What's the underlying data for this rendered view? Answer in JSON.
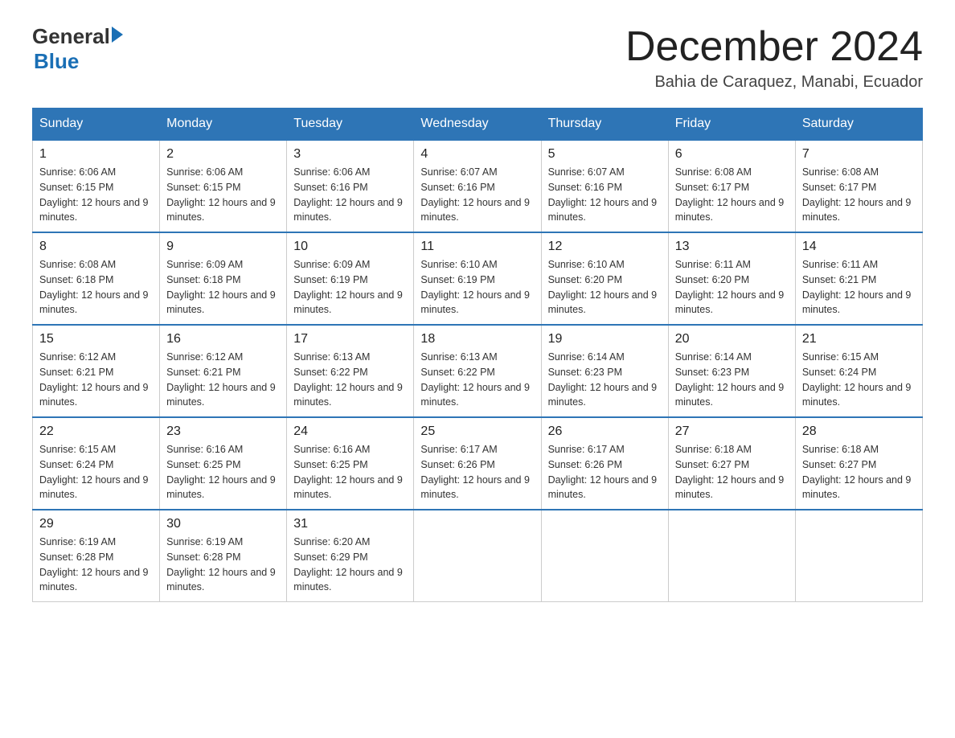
{
  "header": {
    "logo": {
      "general": "General",
      "blue": "Blue"
    },
    "title": "December 2024",
    "subtitle": "Bahia de Caraquez, Manabi, Ecuador"
  },
  "days_of_week": [
    "Sunday",
    "Monday",
    "Tuesday",
    "Wednesday",
    "Thursday",
    "Friday",
    "Saturday"
  ],
  "weeks": [
    [
      {
        "day": "1",
        "sunrise": "6:06 AM",
        "sunset": "6:15 PM",
        "daylight": "12 hours and 9 minutes."
      },
      {
        "day": "2",
        "sunrise": "6:06 AM",
        "sunset": "6:15 PM",
        "daylight": "12 hours and 9 minutes."
      },
      {
        "day": "3",
        "sunrise": "6:06 AM",
        "sunset": "6:16 PM",
        "daylight": "12 hours and 9 minutes."
      },
      {
        "day": "4",
        "sunrise": "6:07 AM",
        "sunset": "6:16 PM",
        "daylight": "12 hours and 9 minutes."
      },
      {
        "day": "5",
        "sunrise": "6:07 AM",
        "sunset": "6:16 PM",
        "daylight": "12 hours and 9 minutes."
      },
      {
        "day": "6",
        "sunrise": "6:08 AM",
        "sunset": "6:17 PM",
        "daylight": "12 hours and 9 minutes."
      },
      {
        "day": "7",
        "sunrise": "6:08 AM",
        "sunset": "6:17 PM",
        "daylight": "12 hours and 9 minutes."
      }
    ],
    [
      {
        "day": "8",
        "sunrise": "6:08 AM",
        "sunset": "6:18 PM",
        "daylight": "12 hours and 9 minutes."
      },
      {
        "day": "9",
        "sunrise": "6:09 AM",
        "sunset": "6:18 PM",
        "daylight": "12 hours and 9 minutes."
      },
      {
        "day": "10",
        "sunrise": "6:09 AM",
        "sunset": "6:19 PM",
        "daylight": "12 hours and 9 minutes."
      },
      {
        "day": "11",
        "sunrise": "6:10 AM",
        "sunset": "6:19 PM",
        "daylight": "12 hours and 9 minutes."
      },
      {
        "day": "12",
        "sunrise": "6:10 AM",
        "sunset": "6:20 PM",
        "daylight": "12 hours and 9 minutes."
      },
      {
        "day": "13",
        "sunrise": "6:11 AM",
        "sunset": "6:20 PM",
        "daylight": "12 hours and 9 minutes."
      },
      {
        "day": "14",
        "sunrise": "6:11 AM",
        "sunset": "6:21 PM",
        "daylight": "12 hours and 9 minutes."
      }
    ],
    [
      {
        "day": "15",
        "sunrise": "6:12 AM",
        "sunset": "6:21 PM",
        "daylight": "12 hours and 9 minutes."
      },
      {
        "day": "16",
        "sunrise": "6:12 AM",
        "sunset": "6:21 PM",
        "daylight": "12 hours and 9 minutes."
      },
      {
        "day": "17",
        "sunrise": "6:13 AM",
        "sunset": "6:22 PM",
        "daylight": "12 hours and 9 minutes."
      },
      {
        "day": "18",
        "sunrise": "6:13 AM",
        "sunset": "6:22 PM",
        "daylight": "12 hours and 9 minutes."
      },
      {
        "day": "19",
        "sunrise": "6:14 AM",
        "sunset": "6:23 PM",
        "daylight": "12 hours and 9 minutes."
      },
      {
        "day": "20",
        "sunrise": "6:14 AM",
        "sunset": "6:23 PM",
        "daylight": "12 hours and 9 minutes."
      },
      {
        "day": "21",
        "sunrise": "6:15 AM",
        "sunset": "6:24 PM",
        "daylight": "12 hours and 9 minutes."
      }
    ],
    [
      {
        "day": "22",
        "sunrise": "6:15 AM",
        "sunset": "6:24 PM",
        "daylight": "12 hours and 9 minutes."
      },
      {
        "day": "23",
        "sunrise": "6:16 AM",
        "sunset": "6:25 PM",
        "daylight": "12 hours and 9 minutes."
      },
      {
        "day": "24",
        "sunrise": "6:16 AM",
        "sunset": "6:25 PM",
        "daylight": "12 hours and 9 minutes."
      },
      {
        "day": "25",
        "sunrise": "6:17 AM",
        "sunset": "6:26 PM",
        "daylight": "12 hours and 9 minutes."
      },
      {
        "day": "26",
        "sunrise": "6:17 AM",
        "sunset": "6:26 PM",
        "daylight": "12 hours and 9 minutes."
      },
      {
        "day": "27",
        "sunrise": "6:18 AM",
        "sunset": "6:27 PM",
        "daylight": "12 hours and 9 minutes."
      },
      {
        "day": "28",
        "sunrise": "6:18 AM",
        "sunset": "6:27 PM",
        "daylight": "12 hours and 9 minutes."
      }
    ],
    [
      {
        "day": "29",
        "sunrise": "6:19 AM",
        "sunset": "6:28 PM",
        "daylight": "12 hours and 9 minutes."
      },
      {
        "day": "30",
        "sunrise": "6:19 AM",
        "sunset": "6:28 PM",
        "daylight": "12 hours and 9 minutes."
      },
      {
        "day": "31",
        "sunrise": "6:20 AM",
        "sunset": "6:29 PM",
        "daylight": "12 hours and 9 minutes."
      },
      null,
      null,
      null,
      null
    ]
  ],
  "labels": {
    "sunrise_prefix": "Sunrise: ",
    "sunset_prefix": "Sunset: ",
    "daylight_prefix": "Daylight: "
  }
}
